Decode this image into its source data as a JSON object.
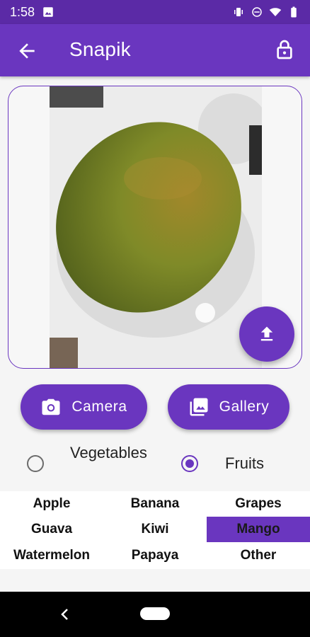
{
  "status": {
    "time": "1:58"
  },
  "app_bar": {
    "title": "Snapik"
  },
  "buttons": {
    "camera_label": "Camera",
    "gallery_label": "Gallery"
  },
  "category": {
    "vegetables_label": "Vegetables",
    "fruits_label": "Fruits",
    "selected": "Fruits"
  },
  "fruits": {
    "items": [
      "Apple",
      "Banana",
      "Grapes",
      "Guava",
      "Kiwi",
      "Mango",
      "Watermelon",
      "Papaya",
      "Other"
    ],
    "selected": "Mango"
  },
  "colors": {
    "primary": "#6a36bf",
    "status_bar": "#5b2aa6",
    "mango": "#8a8f2a"
  },
  "icons": [
    "image-icon",
    "vibrate-icon",
    "do-not-disturb-icon",
    "wifi-icon",
    "battery-icon",
    "back-arrow-icon",
    "lock-icon",
    "upload-icon",
    "camera-icon",
    "gallery-icon",
    "nav-back-icon"
  ]
}
